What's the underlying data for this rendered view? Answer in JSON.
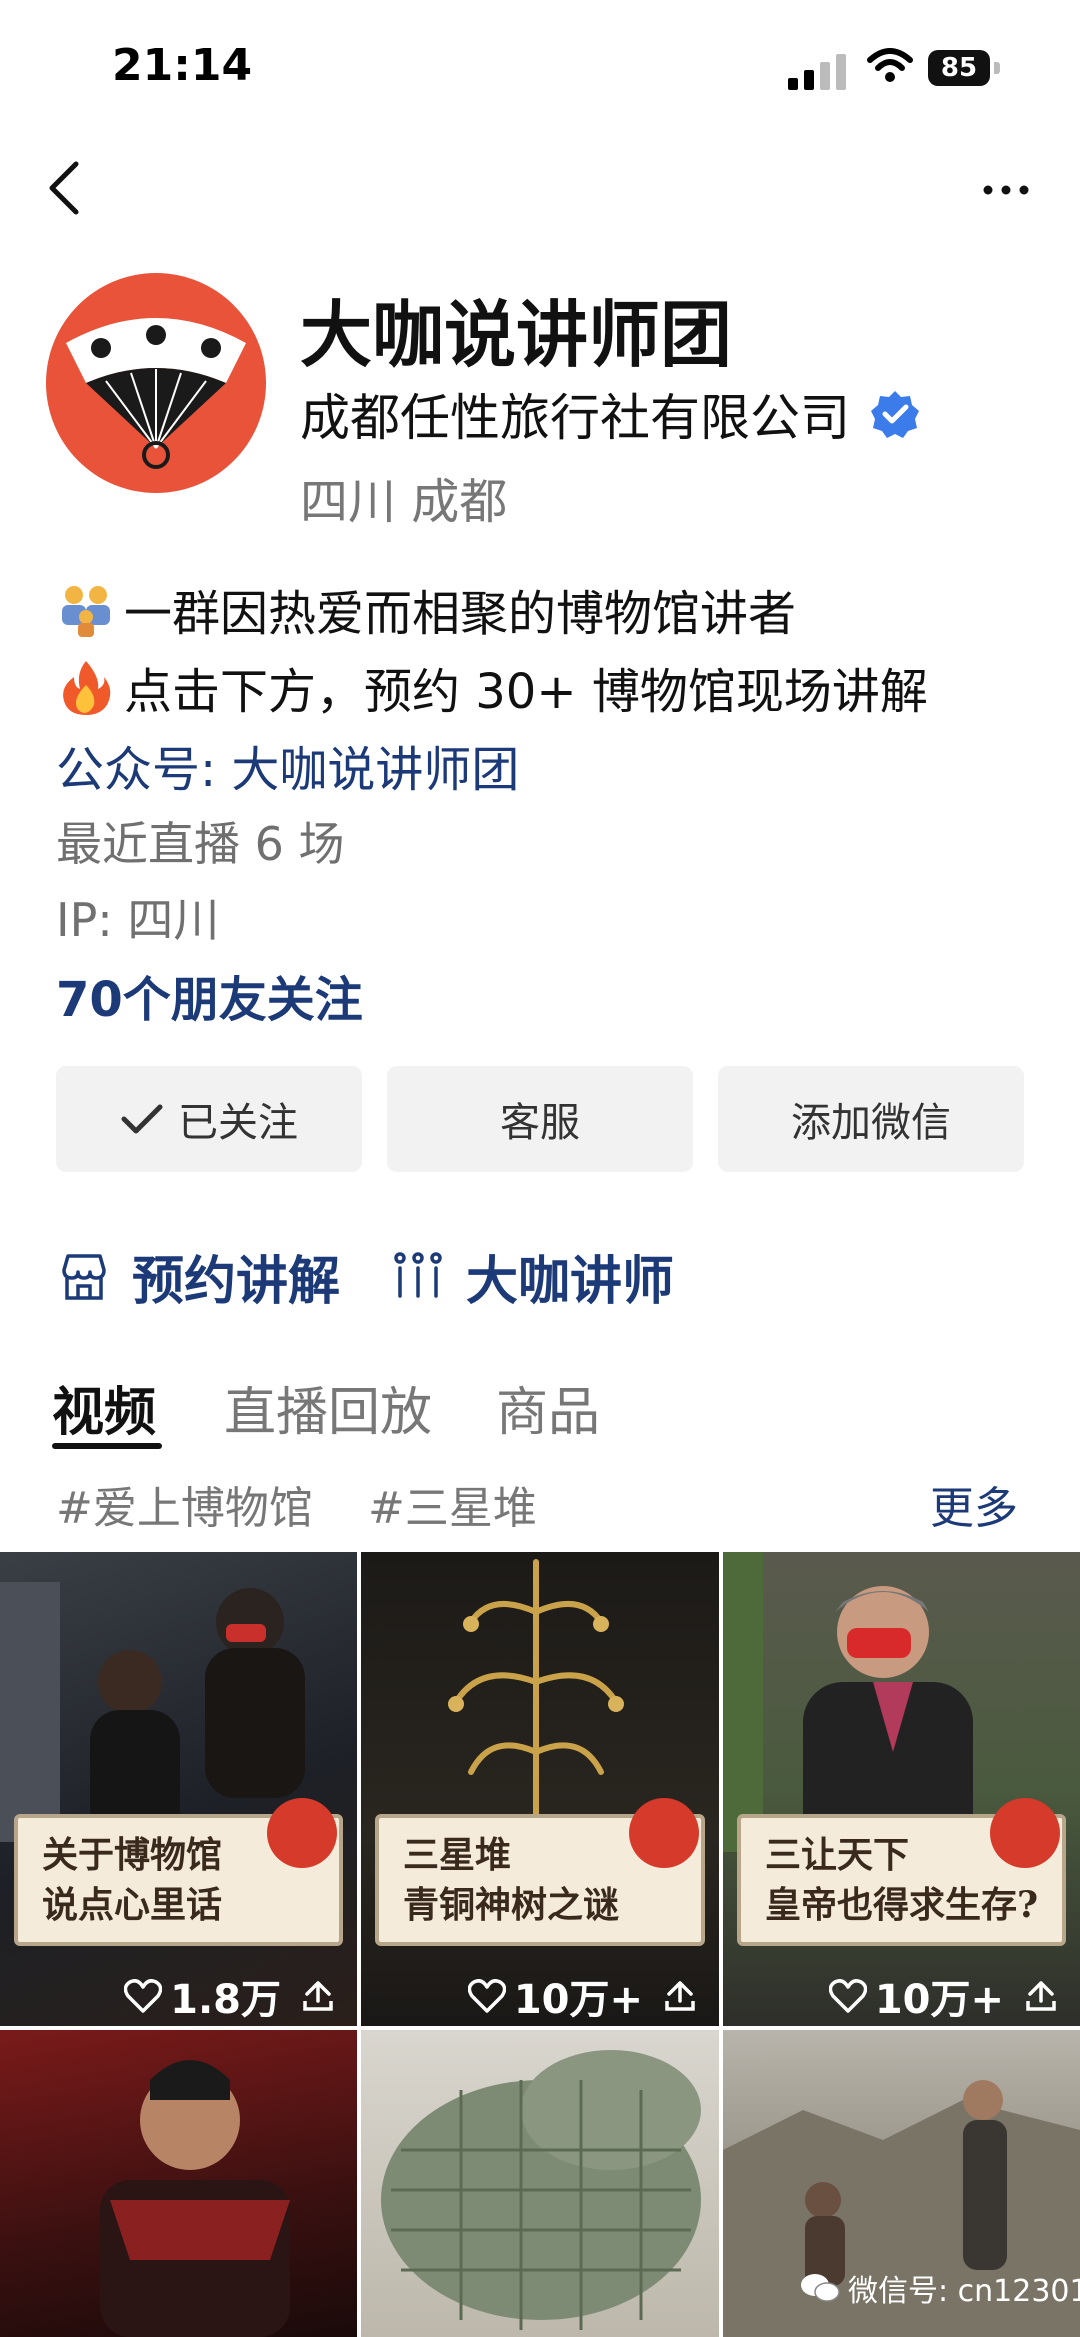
{
  "status_bar": {
    "time": "21:14",
    "battery": "85"
  },
  "profile": {
    "name": "大咖说讲师团",
    "company": "成都任性旅行社有限公司",
    "location": "四川 成都",
    "bio_line1": "一群因热爱而相聚的博物馆讲者",
    "bio_line2": "点击下方，预约 30+ 博物馆现场讲解",
    "official_account": "公众号: 大咖说讲师团",
    "recent_live": "最近直播 6 场",
    "ip": "IP: 四川",
    "friends_follow": "70个朋友关注"
  },
  "buttons": {
    "followed": "已关注",
    "service": "客服",
    "add_wechat": "添加微信"
  },
  "quick_links": {
    "book": "预约讲解",
    "lecturers": "大咖讲师"
  },
  "tabs": [
    "视频",
    "直播回放",
    "商品"
  ],
  "tags": [
    "#爱上博物馆",
    "#三星堆"
  ],
  "more_label": "更多",
  "videos": [
    {
      "caption": "关于博物馆\n说点心里话",
      "likes": "1.8万"
    },
    {
      "caption": "三星堆\n青铜神树之谜",
      "likes": "10万+"
    },
    {
      "caption": "三让天下\n皇帝也得求生存?",
      "likes": "10万+"
    }
  ],
  "watermark": "微信号: cn12301",
  "colors": {
    "link": "#1d3a78",
    "verified": "#3b7bea",
    "avatar": "#e8533a"
  }
}
